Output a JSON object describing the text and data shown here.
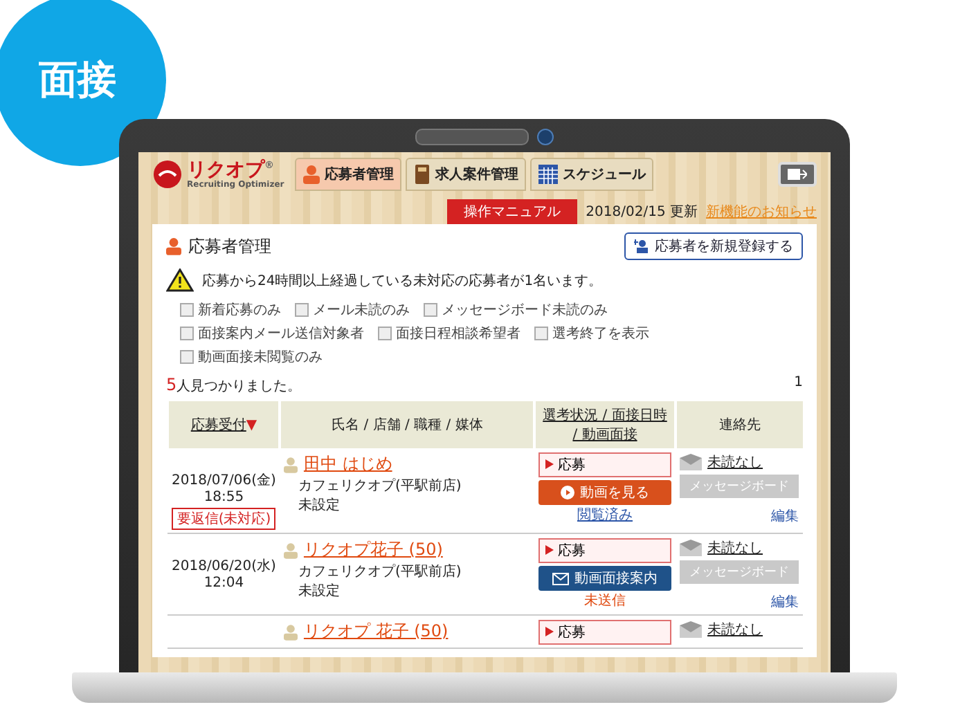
{
  "badge": {
    "label": "面接"
  },
  "app": {
    "logo": {
      "name": "リクオプ",
      "mark": "®",
      "tagline": "Recruiting Optimizer"
    },
    "tabs": [
      {
        "label": "応募者管理",
        "selected": true,
        "kind": "person"
      },
      {
        "label": "求人案件管理",
        "selected": false,
        "kind": "book"
      },
      {
        "label": "スケジュール",
        "selected": false,
        "kind": "calendar"
      }
    ],
    "manual_button": "操作マニュアル",
    "update_date": "2018/02/15 更新",
    "news_link": "新機能のお知らせ"
  },
  "panel": {
    "title": "応募者管理",
    "new_button": "応募者を新規登録する",
    "alert": "応募から24時間以上経過している未対応の応募者が1名います。",
    "filters": [
      {
        "label": "新着応募のみ",
        "checked": false
      },
      {
        "label": "メール未読のみ",
        "checked": false
      },
      {
        "label": "メッセージボード未読のみ",
        "checked": false
      },
      {
        "label": "面接案内メール送信対象者",
        "checked": false
      },
      {
        "label": "面接日程相談希望者",
        "checked": false
      },
      {
        "label": "選考終了を表示",
        "checked": false
      },
      {
        "label": "動画面接未閲覧のみ",
        "checked": false
      }
    ],
    "result_count": "5",
    "result_text": "人見つかりました。",
    "page": "1",
    "columns": [
      {
        "label": "応募受付",
        "sort_mark": "▼",
        "link": true
      },
      {
        "label": "氏名 / 店舗 / 職種 / 媒体",
        "link": false
      },
      {
        "label": "選考状況 / 面接日時 / 動画面接",
        "link": true
      },
      {
        "label": "連絡先",
        "link": false
      }
    ],
    "rows": [
      {
        "date": "2018/07/06(金)",
        "time": "18:55",
        "tag": "要返信(未対応)",
        "name": "田中 はじめ",
        "store": "カフェリクオプ(平駅前店)",
        "job": "未設定",
        "status": "応募",
        "action": {
          "kind": "video",
          "label": "動画を見る"
        },
        "action_note": "閲覧済み",
        "contact": "未読なし",
        "board_button": {
          "label": "メッセージボード",
          "disabled": true
        },
        "edit": "編集"
      },
      {
        "date": "2018/06/20(水)",
        "time": "12:04",
        "name": "リクオプ花子 (50)",
        "store": "カフェリクオプ(平駅前店)",
        "job": "未設定",
        "status": "応募",
        "action": {
          "kind": "invite",
          "label": "動画面接案内"
        },
        "action_note": "未送信",
        "contact": "未読なし",
        "board_button": {
          "label": "メッセージボード",
          "disabled": true
        },
        "edit": "編集"
      },
      {
        "name": "リクオプ 花子 (50)",
        "status": "応募",
        "contact": "未読なし"
      }
    ]
  }
}
